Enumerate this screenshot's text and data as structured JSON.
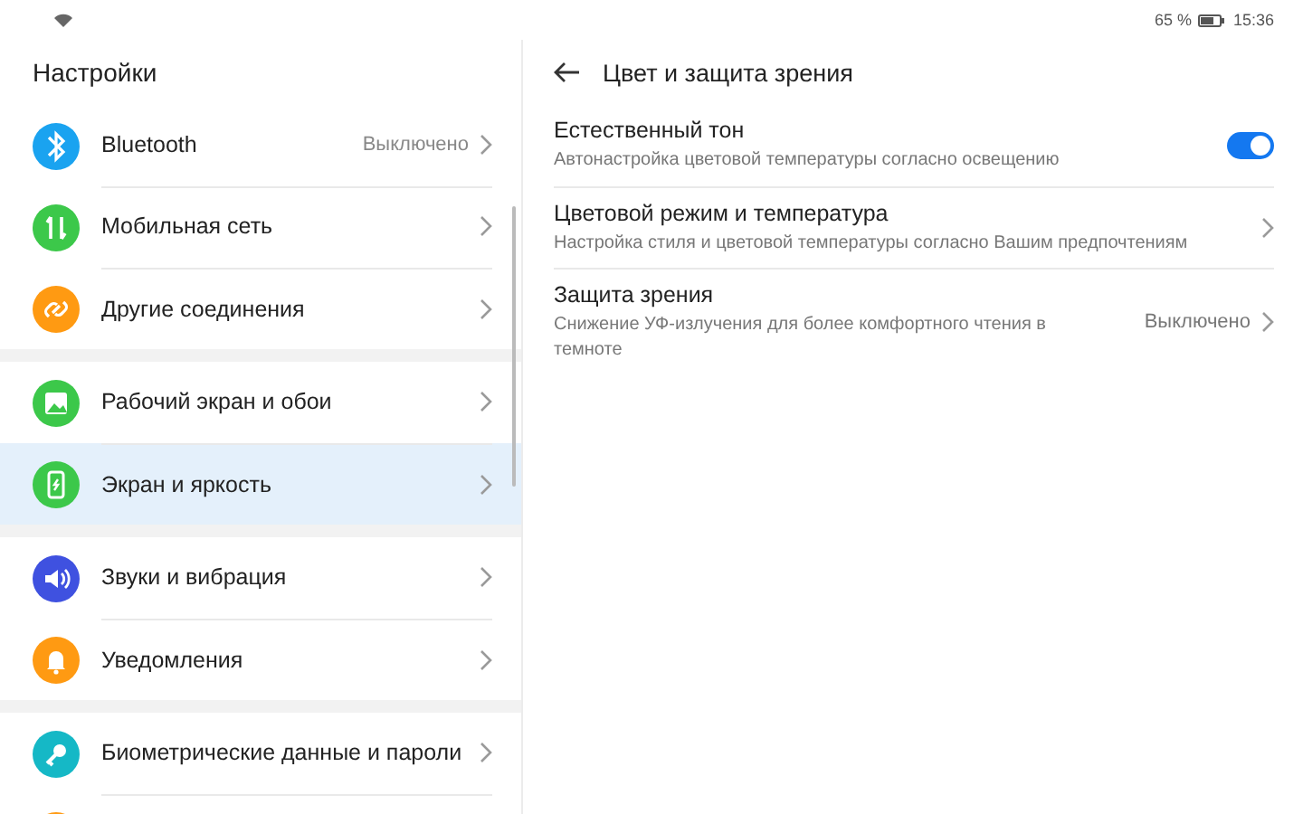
{
  "status_bar": {
    "battery_text": "65 %",
    "time": "15:36"
  },
  "sidebar": {
    "title": "Настройки",
    "groups": [
      {
        "items": [
          {
            "label": "Bluetooth",
            "value": "Выключено",
            "kind": "bluetooth",
            "color": "#1aa3f0",
            "selected": false
          },
          {
            "label": "Мобильная сеть",
            "kind": "mobile",
            "color": "#3cc84a",
            "selected": false
          },
          {
            "label": "Другие соединения",
            "kind": "link",
            "color": "#ff9a12",
            "selected": false
          }
        ]
      },
      {
        "items": [
          {
            "label": "Рабочий экран и обои",
            "kind": "image",
            "color": "#3cc84a",
            "selected": false
          },
          {
            "label": "Экран и яркость",
            "kind": "screen",
            "color": "#3cc84a",
            "selected": true
          }
        ]
      },
      {
        "items": [
          {
            "label": "Звуки и вибрация",
            "kind": "sound",
            "color": "#3f51e0",
            "selected": false
          },
          {
            "label": "Уведомления",
            "kind": "bell",
            "color": "#ff9a12",
            "selected": false
          }
        ]
      },
      {
        "items": [
          {
            "label": "Биометрические данные и пароли",
            "kind": "key",
            "color": "#15b8c6",
            "selected": false
          },
          {
            "kind": "unknown",
            "color": "#ff9a12",
            "selected": false
          }
        ]
      }
    ]
  },
  "detail": {
    "title": "Цвет и защита зрения",
    "items": [
      {
        "kind": "switch",
        "title": "Естественный тон",
        "subtitle": "Автонастройка цветовой температуры согласно освещению",
        "on": true
      },
      {
        "kind": "link",
        "title": "Цветовой режим и температура",
        "subtitle": "Настройка стиля и цветовой температуры согласно Вашим предпочтениям"
      },
      {
        "kind": "value",
        "title": "Защита зрения",
        "subtitle": "Снижение УФ-излучения для более комфортного чтения в темноте",
        "value": "Выключено"
      }
    ]
  }
}
